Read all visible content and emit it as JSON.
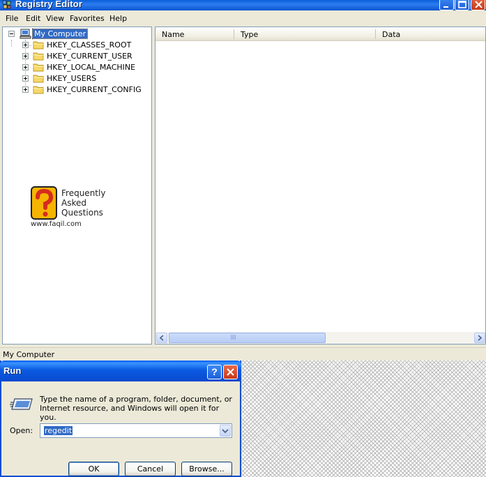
{
  "regedit": {
    "title": "Registry Editor",
    "menu": [
      "File",
      "Edit",
      "View",
      "Favorites",
      "Help"
    ],
    "tree": {
      "root": "My Computer",
      "keys": [
        "HKEY_CLASSES_ROOT",
        "HKEY_CURRENT_USER",
        "HKEY_LOCAL_MACHINE",
        "HKEY_USERS",
        "HKEY_CURRENT_CONFIG"
      ]
    },
    "columns": [
      "Name",
      "Type",
      "Data"
    ],
    "status": "My Computer",
    "watermark": {
      "lines": [
        "Frequently",
        "Asked",
        "Questions"
      ],
      "url": "www.faqil.com"
    }
  },
  "run": {
    "title": "Run",
    "description": "Type the name of a program, folder, document, or Internet resource, and Windows will open it for you.",
    "open_label": "Open:",
    "open_value": "regedit",
    "buttons": {
      "ok": "OK",
      "cancel": "Cancel",
      "browse": "Browse..."
    },
    "help_glyph": "?",
    "icons": [
      "run-icon",
      "help-icon",
      "close-icon"
    ]
  },
  "colors": {
    "titlebar": "#0a5fd8",
    "selection": "#316ac5",
    "close": "#c5391b",
    "window_face": "#ece9d8"
  }
}
